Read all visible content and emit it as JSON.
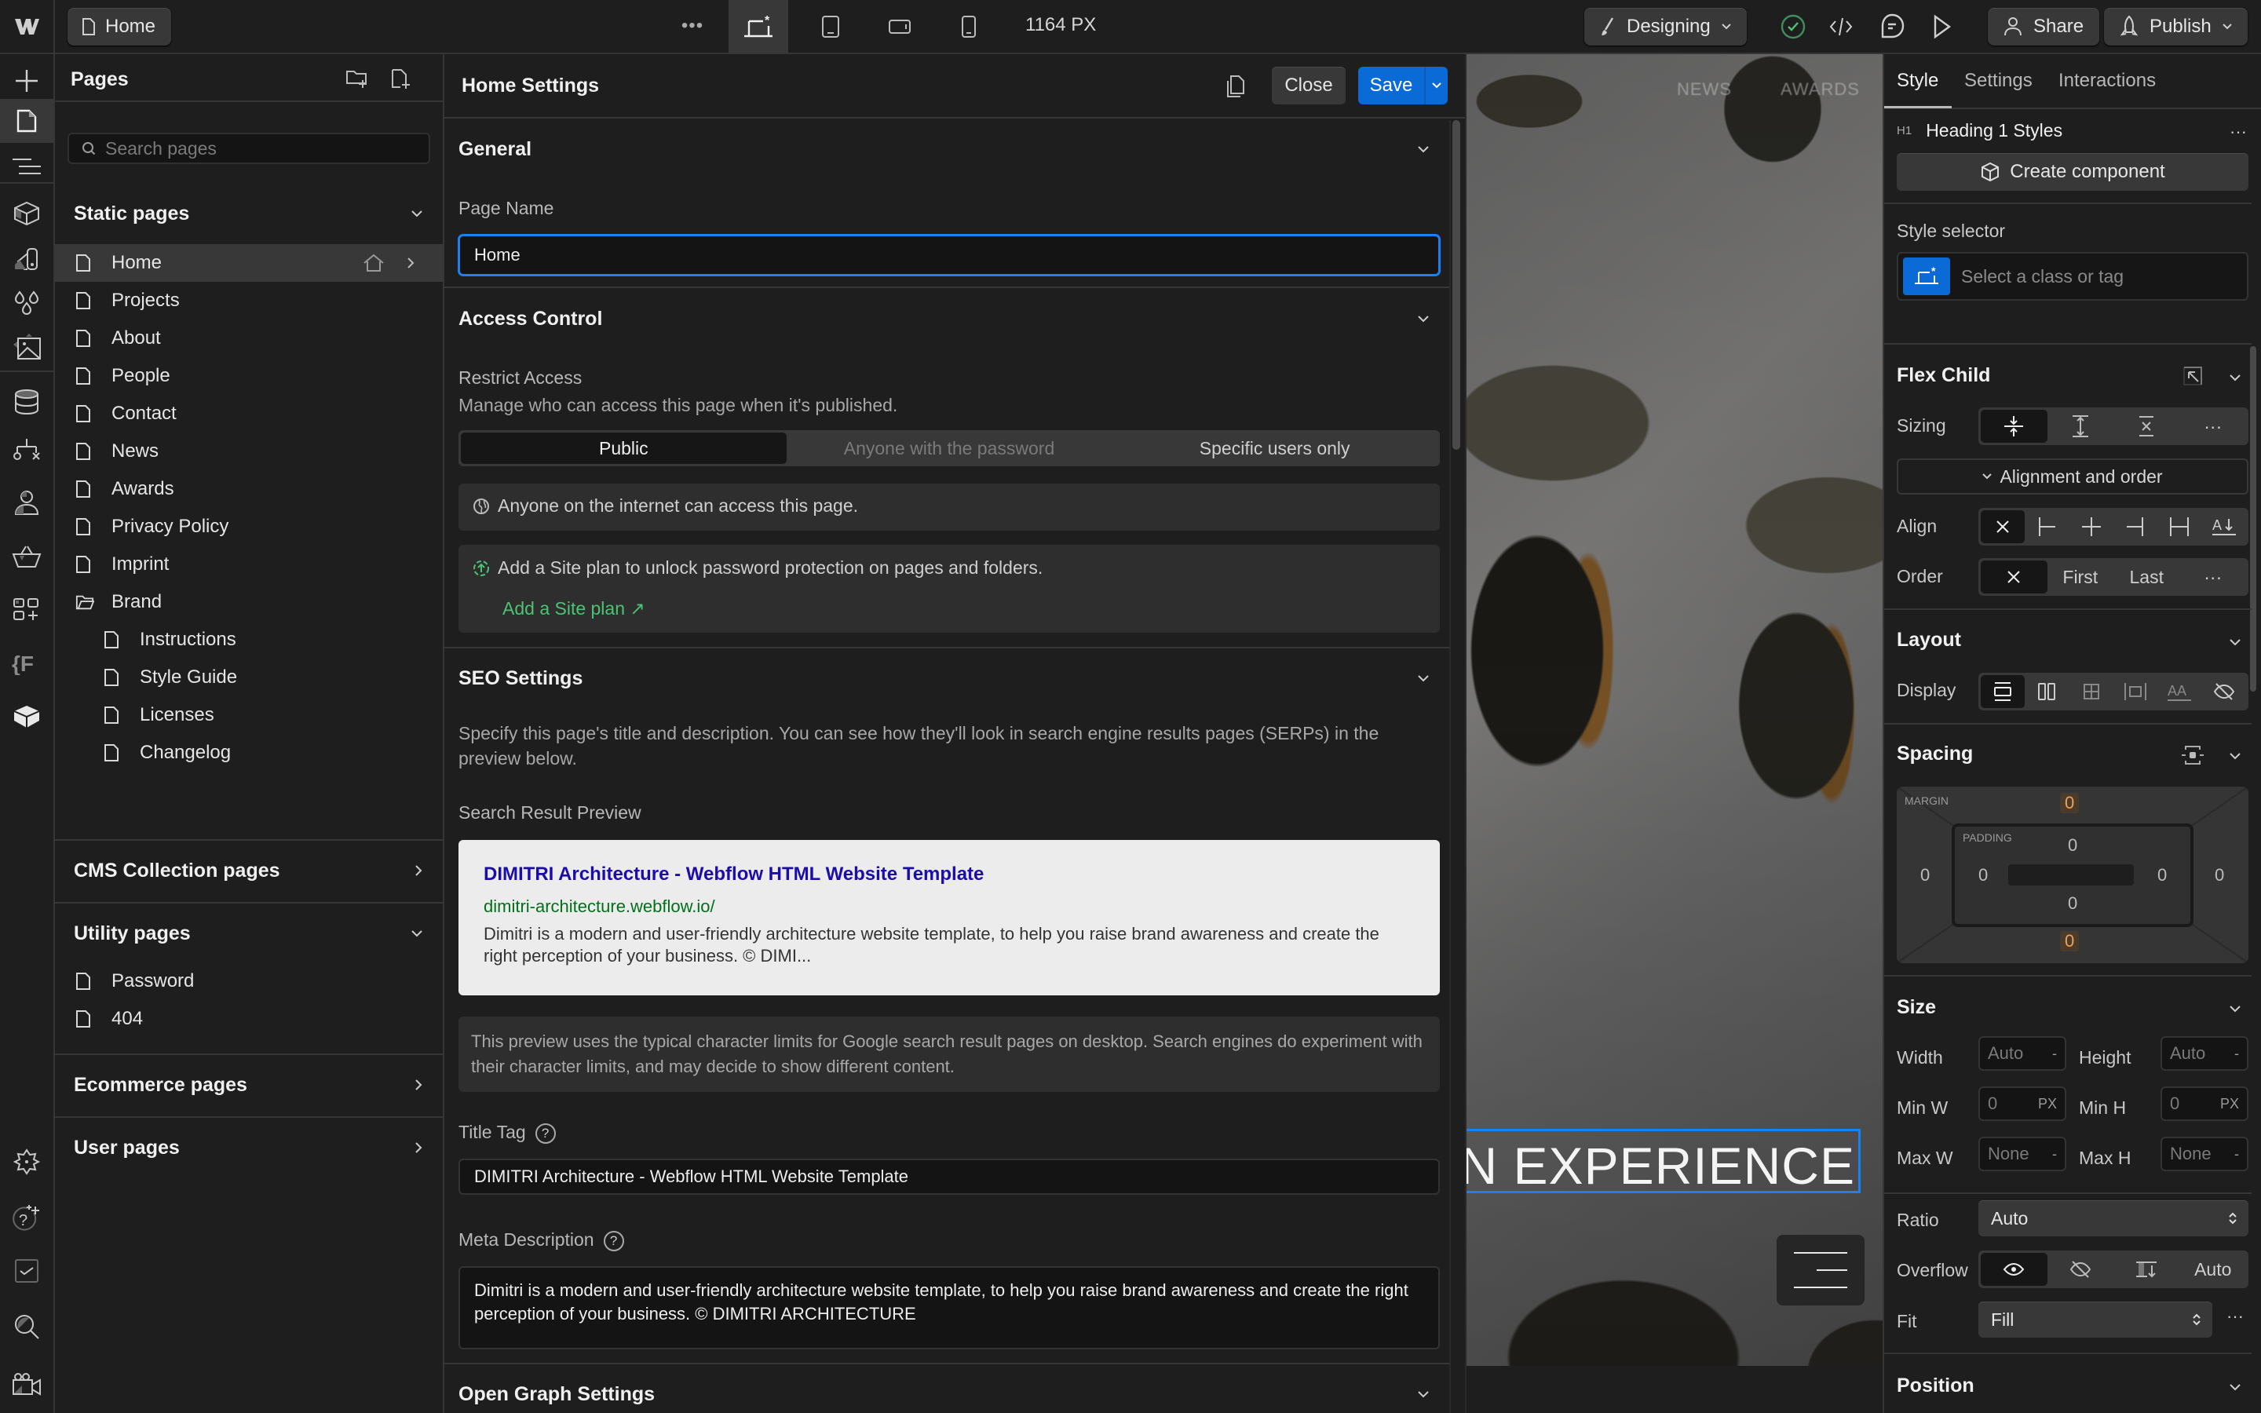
{
  "topbar": {
    "app_logo": "webflow-logo",
    "current_page": "Home",
    "more_label": "•••",
    "breakpoints": [
      {
        "name": "desktop-base",
        "active": true
      },
      {
        "name": "tablet",
        "active": false
      },
      {
        "name": "mobile-landscape",
        "active": false
      },
      {
        "name": "mobile-portrait",
        "active": false
      }
    ],
    "canvas_width": "1164 PX",
    "mode_label": "Designing",
    "share_label": "Share",
    "publish_label": "Publish",
    "status_color": "#4ec274"
  },
  "rail": {
    "items": [
      "add-elements",
      "pages",
      "navigator",
      "components",
      "variables",
      "styles",
      "assets",
      "cms",
      "logic",
      "users",
      "ecommerce",
      "apps",
      "finsweet",
      "libraries"
    ],
    "bottom_items": [
      "settings",
      "help",
      "audit",
      "search",
      "video-tutorials"
    ]
  },
  "pages_panel": {
    "title": "Pages",
    "search_placeholder": "Search pages",
    "static_header": "Static pages",
    "static_pages": [
      {
        "label": "Home",
        "selected": true,
        "is_home": true
      },
      {
        "label": "Projects"
      },
      {
        "label": "About"
      },
      {
        "label": "People"
      },
      {
        "label": "Contact"
      },
      {
        "label": "News"
      },
      {
        "label": "Awards"
      },
      {
        "label": "Privacy Policy"
      },
      {
        "label": "Imprint"
      }
    ],
    "folder": {
      "label": "Brand",
      "children": [
        "Instructions",
        "Style Guide",
        "Licenses",
        "Changelog"
      ]
    },
    "cms_header": "CMS Collection pages",
    "utility_header": "Utility pages",
    "utility_pages": [
      "Password",
      "404"
    ],
    "ecommerce_header": "Ecommerce pages",
    "user_header": "User pages"
  },
  "settings": {
    "title": "Home Settings",
    "close_label": "Close",
    "save_label": "Save",
    "general": {
      "header": "General",
      "page_name_label": "Page Name",
      "page_name_value": "Home"
    },
    "access": {
      "header": "Access Control",
      "restrict_label": "Restrict Access",
      "restrict_desc": "Manage who can access this page when it's published.",
      "options": [
        "Public",
        "Anyone with the password",
        "Specific users only"
      ],
      "selected": "Public",
      "public_note": "Anyone on the internet can access this page.",
      "upgrade_note": "Add a Site plan to unlock password protection on pages and folders.",
      "upgrade_link": "Add a Site plan ↗"
    },
    "seo": {
      "header": "SEO Settings",
      "desc": "Specify this page's title and description. You can see how they'll look in search engine results pages (SERPs) in the preview below.",
      "preview_label": "Search Result Preview",
      "preview_title": "DIMITRI Architecture - Webflow HTML Website Template",
      "preview_url": "dimitri-architecture.webflow.io/",
      "preview_desc": "Dimitri is a modern and user-friendly architecture website template, to help you raise brand awareness and create the right perception of your business. © DIMI...",
      "preview_note": "This preview uses the typical character limits for Google search result pages on desktop. Search engines do experiment with their character limits, and may decide to show different content.",
      "title_tag_label": "Title Tag",
      "title_tag_value": "DIMITRI Architecture - Webflow HTML Website Template",
      "meta_desc_label": "Meta Description",
      "meta_desc_value": "Dimitri is a modern and user-friendly architecture website template, to help you raise brand awareness and create the right perception of your business. © DIMITRI ARCHITECTURE",
      "help_glyph": "?"
    },
    "open_graph": {
      "header": "Open Graph Settings"
    }
  },
  "canvas": {
    "nav_items": [
      "NEWS",
      "AWARDS"
    ],
    "heading_text": "MAN EXPERIENCE",
    "selection_color": "#1a82f0"
  },
  "style_panel": {
    "tabs": [
      "Style",
      "Settings",
      "Interactions"
    ],
    "active_tab": "Style",
    "element_tag": "H1",
    "element_label": "Heading 1 Styles",
    "create_component_label": "Create component",
    "selector_label": "Style selector",
    "selector_placeholder": "Select a class or tag",
    "flex_child": {
      "header": "Flex Child",
      "sizing_label": "Sizing",
      "alignment_toggle": "Alignment and order",
      "align_label": "Align",
      "order_label": "Order",
      "order_options": [
        "First",
        "Last"
      ]
    },
    "layout": {
      "header": "Layout",
      "display_label": "Display"
    },
    "spacing": {
      "header": "Spacing",
      "margin_label": "MARGIN",
      "padding_label": "PADDING",
      "margin": {
        "top": "0",
        "right": "0",
        "bottom": "0",
        "left": "0"
      },
      "padding": {
        "top": "0",
        "right": "0",
        "bottom": "0",
        "left": "0"
      },
      "modified_color": "#f0a05a"
    },
    "size": {
      "header": "Size",
      "width_label": "Width",
      "width_value": "Auto",
      "width_unit": "-",
      "height_label": "Height",
      "height_value": "Auto",
      "height_unit": "-",
      "min_w_label": "Min W",
      "min_w_value": "0",
      "min_w_unit": "PX",
      "min_h_label": "Min H",
      "min_h_value": "0",
      "min_h_unit": "PX",
      "max_w_label": "Max W",
      "max_w_value": "None",
      "max_w_unit": "-",
      "max_h_label": "Max H",
      "max_h_value": "None",
      "max_h_unit": "-",
      "ratio_label": "Ratio",
      "ratio_value": "Auto",
      "overflow_label": "Overflow",
      "overflow_auto": "Auto",
      "fit_label": "Fit",
      "fit_value": "Fill"
    },
    "position": {
      "header": "Position"
    }
  }
}
